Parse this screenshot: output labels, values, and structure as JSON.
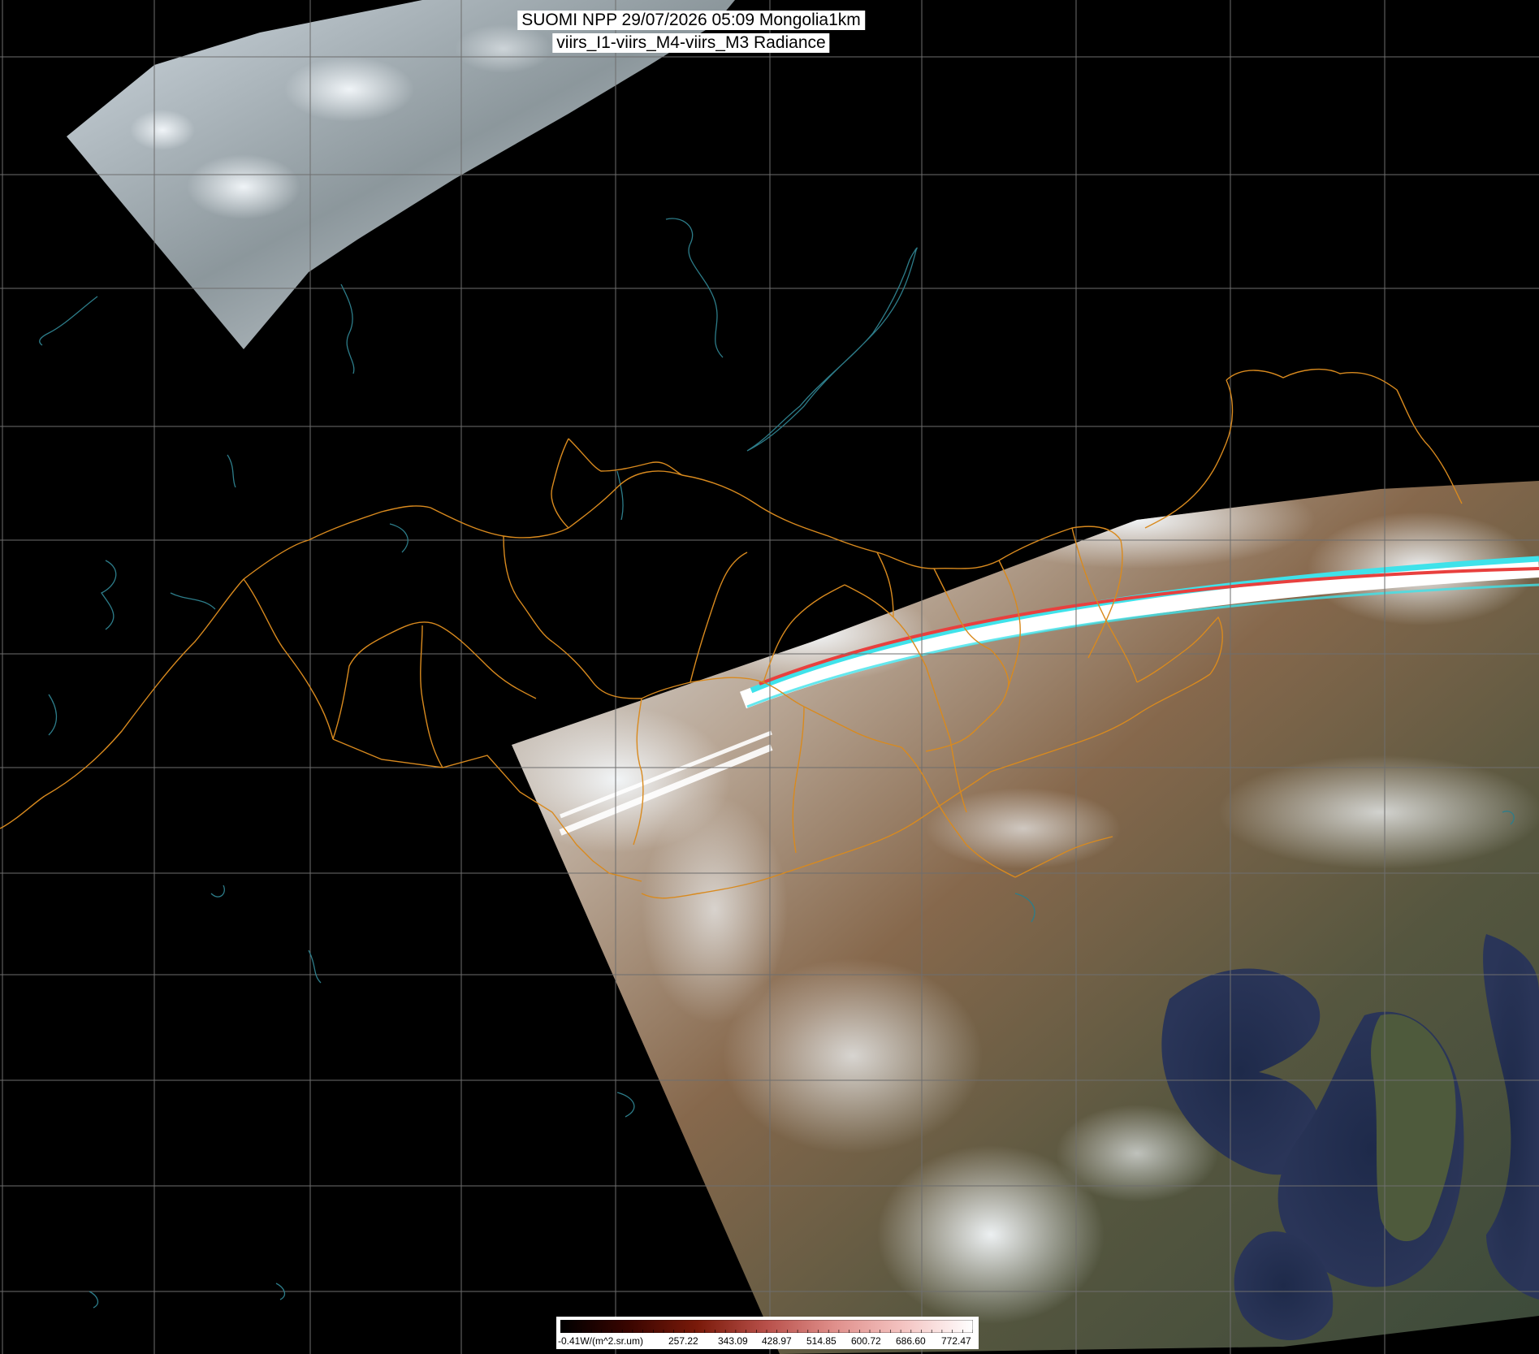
{
  "title": {
    "line1": "SUOMI NPP 29/07/2026 05:09 Mongolia1km",
    "line2": "viirs_I1-viirs_M4-viirs_M3 Radiance"
  },
  "colorbar": {
    "labels": [
      "-0.41W/(m^2.sr.um)",
      "257.22",
      "343.09",
      "428.97",
      "514.85",
      "600.72",
      "686.60",
      "772.47"
    ],
    "stops": [
      "#000000",
      "#3a0500",
      "#7a1a0a",
      "#b8504a",
      "#e0908c",
      "#f4c4c2",
      "#ffffff"
    ]
  },
  "colors": {
    "background": "#000000",
    "grid": "#6e6e6e",
    "borders": "#d98a1e",
    "coast": "#2d7d8a",
    "stripe_cyan": "#3fe2ea",
    "stripe_red": "#e8403e"
  }
}
